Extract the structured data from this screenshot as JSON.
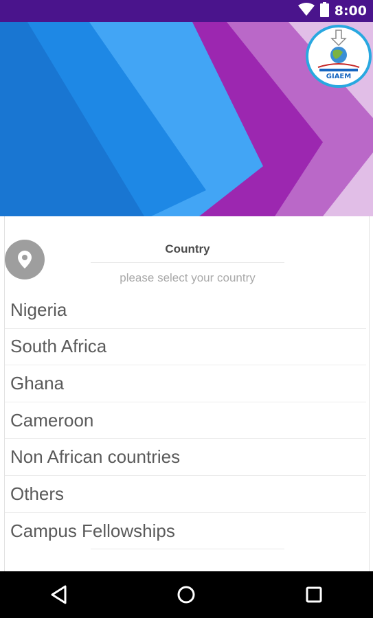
{
  "status_bar": {
    "time": "8:00",
    "icons": [
      "wifi-icon",
      "battery-icon"
    ],
    "background": "#4a148c"
  },
  "header": {
    "logo_text": "GIAEM",
    "colors": [
      "#1e88e5",
      "#42a5f5",
      "#9c27b0",
      "#ba68c8",
      "#e1bee7"
    ]
  },
  "country_card": {
    "title": "Country",
    "subtitle": "please select your country",
    "icon": "location-pin-icon",
    "countries": [
      "Nigeria",
      "South Africa",
      "Ghana",
      "Cameroon",
      "Non African countries",
      "Others",
      "Campus Fellowships"
    ]
  },
  "nav_bar": {
    "buttons": [
      "back-icon",
      "home-icon",
      "recents-icon"
    ]
  }
}
